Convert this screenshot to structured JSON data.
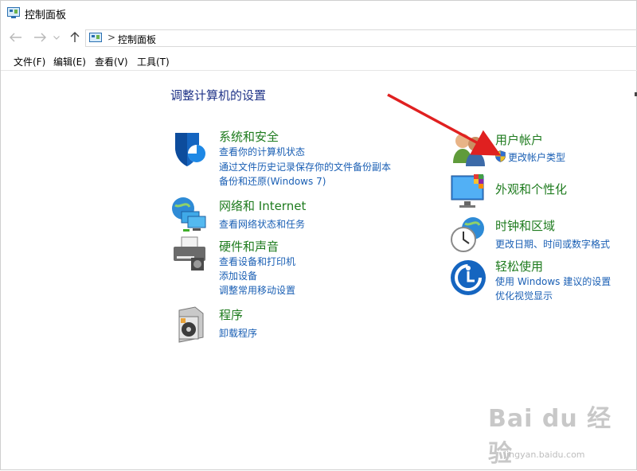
{
  "window": {
    "title": "控制面板"
  },
  "address": {
    "separator": ">",
    "crumb": "控制面板"
  },
  "menu": {
    "file": "文件(F)",
    "edit": "编辑(E)",
    "view": "查看(V)",
    "tools": "工具(T)"
  },
  "main": {
    "heading": "调整计算机的设置",
    "left": [
      {
        "title": "系统和安全",
        "icon": "shield-icon",
        "links": [
          "查看你的计算机状态",
          "通过文件历史记录保存你的文件备份副本",
          "备份和还原(Windows 7)"
        ]
      },
      {
        "title": "网络和 Internet",
        "icon": "network-icon",
        "links": [
          "查看网络状态和任务"
        ]
      },
      {
        "title": "硬件和声音",
        "icon": "printer-icon",
        "links": [
          "查看设备和打印机",
          "添加设备",
          "调整常用移动设置"
        ]
      },
      {
        "title": "程序",
        "icon": "programs-icon",
        "links": [
          "卸载程序"
        ]
      }
    ],
    "right": [
      {
        "title": "用户帐户",
        "icon": "users-icon",
        "links": [
          "更改帐户类型"
        ]
      },
      {
        "title": "外观和个性化",
        "icon": "appearance-icon",
        "links": []
      },
      {
        "title": "时钟和区域",
        "icon": "clock-globe-icon",
        "links": [
          "更改日期、时间或数字格式"
        ]
      },
      {
        "title": "轻松使用",
        "icon": "ease-of-access-icon",
        "links": [
          "使用 Windows 建议的设置",
          "优化视觉显示"
        ]
      }
    ]
  },
  "watermark": {
    "main": "Bai du 经验",
    "sub": "jingyan.baidu.com"
  },
  "colors": {
    "category": "#1e7b1e",
    "link": "#1a5fb4",
    "heading": "#1e3287",
    "arrow": "#e02020"
  }
}
